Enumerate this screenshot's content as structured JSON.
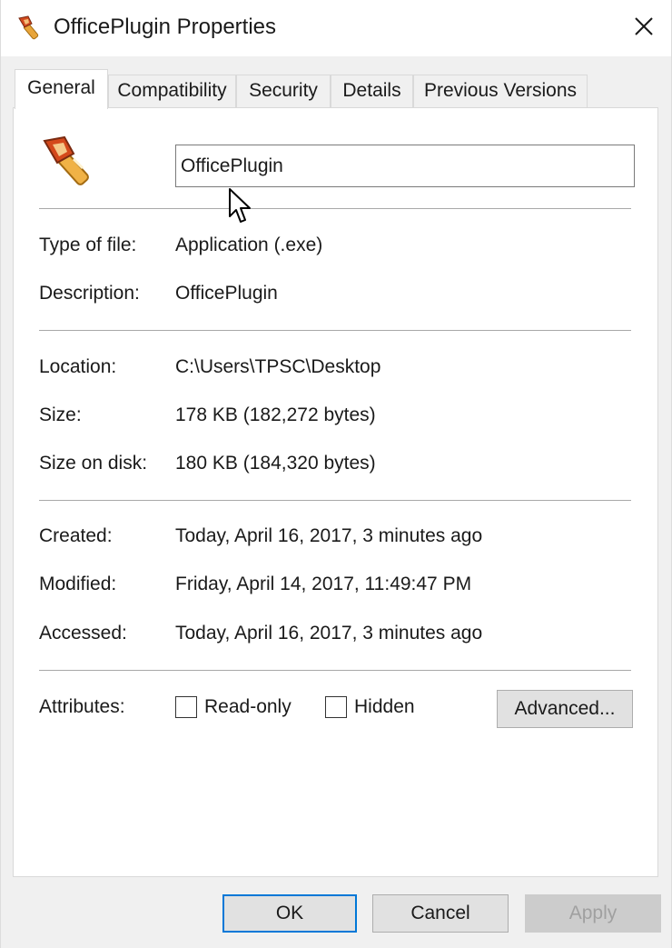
{
  "window": {
    "title": "OfficePlugin Properties"
  },
  "tabs": [
    {
      "label": "General"
    },
    {
      "label": "Compatibility"
    },
    {
      "label": "Security"
    },
    {
      "label": "Details"
    },
    {
      "label": "Previous Versions"
    }
  ],
  "general": {
    "file_name": "OfficePlugin",
    "type_label": "Type of file:",
    "type_value": "Application (.exe)",
    "description_label": "Description:",
    "description_value": "OfficePlugin",
    "location_label": "Location:",
    "location_value": "C:\\Users\\TPSC\\Desktop",
    "size_label": "Size:",
    "size_value": "178 KB (182,272 bytes)",
    "size_on_disk_label": "Size on disk:",
    "size_on_disk_value": "180 KB (184,320 bytes)",
    "created_label": "Created:",
    "created_value": "Today, April 16, 2017, 3 minutes ago",
    "modified_label": "Modified:",
    "modified_value": "Friday, April 14, 2017, 11:49:47 PM",
    "accessed_label": "Accessed:",
    "accessed_value": "Today, April 16, 2017, 3 minutes ago",
    "attributes_label": "Attributes:",
    "readonly_label": "Read-only",
    "readonly_checked": false,
    "hidden_label": "Hidden",
    "hidden_checked": false,
    "advanced_label": "Advanced..."
  },
  "buttons": {
    "ok": "OK",
    "cancel": "Cancel",
    "apply": "Apply"
  },
  "icons": {
    "title_icon": "torch-icon",
    "file_icon": "torch-icon",
    "close_icon": "close-icon"
  },
  "colors": {
    "focus_border": "#0078d7",
    "window_bg": "#f0f0f0",
    "panel_bg": "#ffffff"
  }
}
